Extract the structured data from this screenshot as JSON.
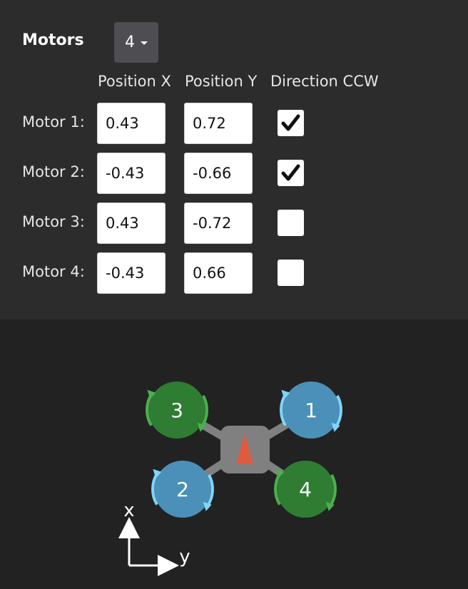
{
  "motors": {
    "label": "Motors",
    "count": "4",
    "headers": [
      "Position X",
      "Position Y",
      "Direction CCW"
    ],
    "rows": [
      {
        "label": "Motor 1:",
        "x": "0.43",
        "y": "0.72",
        "ccw": true
      },
      {
        "label": "Motor 2:",
        "x": "-0.43",
        "y": "-0.66",
        "ccw": true
      },
      {
        "label": "Motor 3:",
        "x": "0.43",
        "y": "-0.72",
        "ccw": false
      },
      {
        "label": "Motor 4:",
        "x": "-0.43",
        "y": "0.66",
        "ccw": false
      }
    ]
  },
  "diagram": {
    "motor_numbers": [
      "1",
      "2",
      "3",
      "4"
    ],
    "axis_x_label": "x",
    "axis_y_label": "y",
    "colors": {
      "ccw_motor": "#2e7d32",
      "ccw_arrow": "#4caf50",
      "cw_motor": "#4a90b8",
      "cw_arrow": "#81d4fa",
      "frame": "#808080",
      "heading_arrow": "#e05a40"
    }
  }
}
